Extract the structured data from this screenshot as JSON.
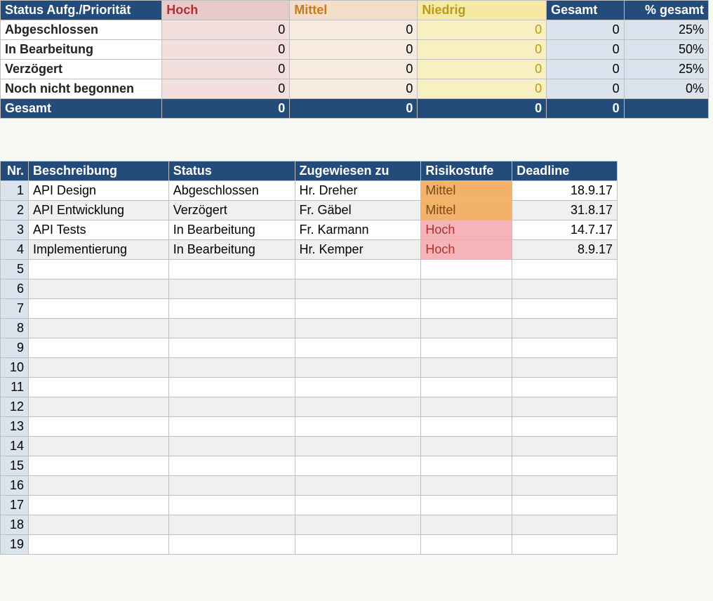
{
  "summary": {
    "headers": {
      "status": "Status Aufg./Priorität",
      "hoch": "Hoch",
      "mittel": "Mittel",
      "niedrig": "Niedrig",
      "gesamt": "Gesamt",
      "pct": "% gesamt"
    },
    "rows": [
      {
        "label": "Abgeschlossen",
        "hoch": "0",
        "mittel": "0",
        "niedrig": "0",
        "gesamt": "0",
        "pct": "25%"
      },
      {
        "label": "In Bearbeitung",
        "hoch": "0",
        "mittel": "0",
        "niedrig": "0",
        "gesamt": "0",
        "pct": "50%"
      },
      {
        "label": "Verzögert",
        "hoch": "0",
        "mittel": "0",
        "niedrig": "0",
        "gesamt": "0",
        "pct": "25%"
      },
      {
        "label": "Noch nicht begonnen",
        "hoch": "0",
        "mittel": "0",
        "niedrig": "0",
        "gesamt": "0",
        "pct": "0%"
      }
    ],
    "total": {
      "label": "Gesamt",
      "hoch": "0",
      "mittel": "0",
      "niedrig": "0",
      "gesamt": "0",
      "pct": ""
    }
  },
  "tasks": {
    "headers": {
      "nr": "Nr.",
      "desc": "Beschreibung",
      "status": "Status",
      "assigned": "Zugewiesen zu",
      "risk": "Risikostufe",
      "deadline": "Deadline"
    },
    "rows": [
      {
        "nr": "1",
        "desc": "API Design",
        "status": "Abgeschlossen",
        "assigned": "Hr. Dreher",
        "risk": "Mittel",
        "risk_class": "risk-mittel",
        "deadline": "18.9.17"
      },
      {
        "nr": "2",
        "desc": "API Entwicklung",
        "status": "Verzögert",
        "assigned": "Fr. Gäbel",
        "risk": "Mittel",
        "risk_class": "risk-mittel",
        "deadline": "31.8.17"
      },
      {
        "nr": "3",
        "desc": "API Tests",
        "status": "In Bearbeitung",
        "assigned": "Fr. Karmann",
        "risk": "Hoch",
        "risk_class": "risk-hoch",
        "deadline": "14.7.17"
      },
      {
        "nr": "4",
        "desc": "Implementierung",
        "status": "In Bearbeitung",
        "assigned": "Hr. Kemper",
        "risk": "Hoch",
        "risk_class": "risk-hoch",
        "deadline": "8.9.17"
      },
      {
        "nr": "5",
        "desc": "",
        "status": "",
        "assigned": "",
        "risk": "",
        "risk_class": "",
        "deadline": ""
      },
      {
        "nr": "6",
        "desc": "",
        "status": "",
        "assigned": "",
        "risk": "",
        "risk_class": "",
        "deadline": ""
      },
      {
        "nr": "7",
        "desc": "",
        "status": "",
        "assigned": "",
        "risk": "",
        "risk_class": "",
        "deadline": ""
      },
      {
        "nr": "8",
        "desc": "",
        "status": "",
        "assigned": "",
        "risk": "",
        "risk_class": "",
        "deadline": ""
      },
      {
        "nr": "9",
        "desc": "",
        "status": "",
        "assigned": "",
        "risk": "",
        "risk_class": "",
        "deadline": ""
      },
      {
        "nr": "10",
        "desc": "",
        "status": "",
        "assigned": "",
        "risk": "",
        "risk_class": "",
        "deadline": ""
      },
      {
        "nr": "11",
        "desc": "",
        "status": "",
        "assigned": "",
        "risk": "",
        "risk_class": "",
        "deadline": ""
      },
      {
        "nr": "12",
        "desc": "",
        "status": "",
        "assigned": "",
        "risk": "",
        "risk_class": "",
        "deadline": ""
      },
      {
        "nr": "13",
        "desc": "",
        "status": "",
        "assigned": "",
        "risk": "",
        "risk_class": "",
        "deadline": ""
      },
      {
        "nr": "14",
        "desc": "",
        "status": "",
        "assigned": "",
        "risk": "",
        "risk_class": "",
        "deadline": ""
      },
      {
        "nr": "15",
        "desc": "",
        "status": "",
        "assigned": "",
        "risk": "",
        "risk_class": "",
        "deadline": ""
      },
      {
        "nr": "16",
        "desc": "",
        "status": "",
        "assigned": "",
        "risk": "",
        "risk_class": "",
        "deadline": ""
      },
      {
        "nr": "17",
        "desc": "",
        "status": "",
        "assigned": "",
        "risk": "",
        "risk_class": "",
        "deadline": ""
      },
      {
        "nr": "18",
        "desc": "",
        "status": "",
        "assigned": "",
        "risk": "",
        "risk_class": "",
        "deadline": ""
      },
      {
        "nr": "19",
        "desc": "",
        "status": "",
        "assigned": "",
        "risk": "",
        "risk_class": "",
        "deadline": ""
      }
    ]
  }
}
